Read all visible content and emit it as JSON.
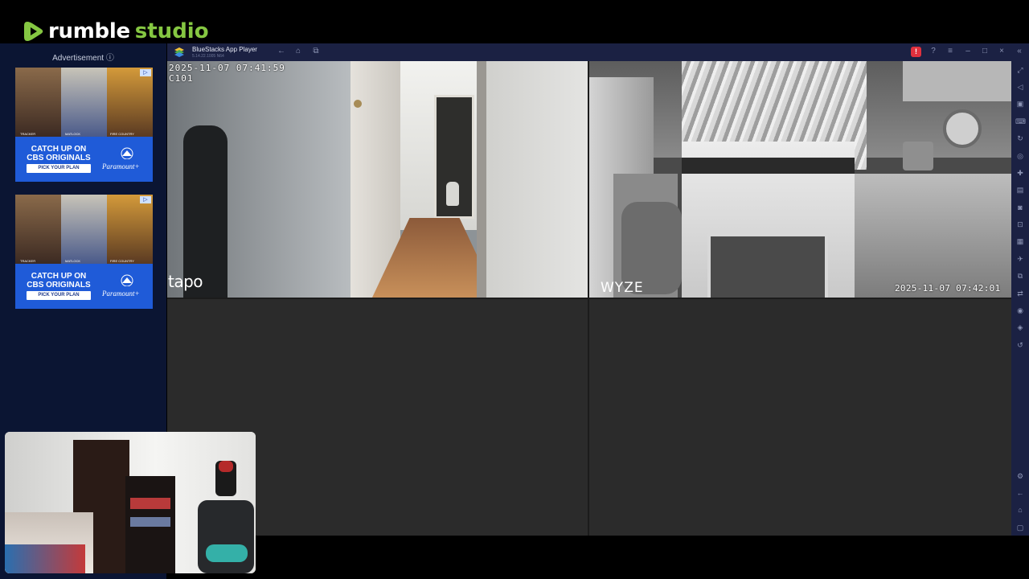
{
  "rumble": {
    "brand_word": "rumble",
    "brand_suffix": "studio",
    "brand_color": "#85c742"
  },
  "ad_panel": {
    "label": "Advertisement ⓘ",
    "ads": [
      {
        "catch": "CATCH UP ON CBS ORIGINALS",
        "cta": "PICK YOUR PLAN",
        "brand": "Paramount+",
        "names": [
          "TRACKER",
          "MATLOCK",
          "FIRE COUNTRY"
        ]
      },
      {
        "catch": "CATCH UP ON CBS ORIGINALS",
        "cta": "PICK YOUR PLAN",
        "brand": "Paramount+",
        "names": [
          "TRACKER",
          "MATLOCK",
          "FIRE COUNTRY"
        ]
      }
    ]
  },
  "bluestacks": {
    "title": "BlueStacks App Player",
    "version": "5.14.22.1005 N64",
    "titlebar_icons": [
      "back-icon",
      "home-icon",
      "multi-instance-icon"
    ],
    "window_icons": [
      "notification-icon",
      "help-icon",
      "menu-icon",
      "minimize-icon",
      "maximize-icon",
      "close-icon",
      "collapse-sidebar-icon"
    ],
    "sidebar_icons": [
      "fullscreen-icon",
      "volume-icon",
      "screen-record-icon",
      "keyboard-controls-icon",
      "rotate-icon",
      "shake-icon",
      "gamepad-icon",
      "media-manager-icon",
      "screenshot-icon",
      "record-icon",
      "multi-instance-icon",
      "apk-install-icon",
      "macro-icon",
      "sync-icon",
      "location-icon",
      "layers-icon",
      "eco-mode-icon",
      "settings-icon",
      "back-icon",
      "home-icon",
      "recent-apps-icon"
    ]
  },
  "cameras": [
    {
      "brand": "tapo",
      "timestamp": "2025-11-07 07:41:59\nC101"
    },
    {
      "brand": "WYZE",
      "timestamp": "2025-11-07 07:42:01"
    }
  ]
}
